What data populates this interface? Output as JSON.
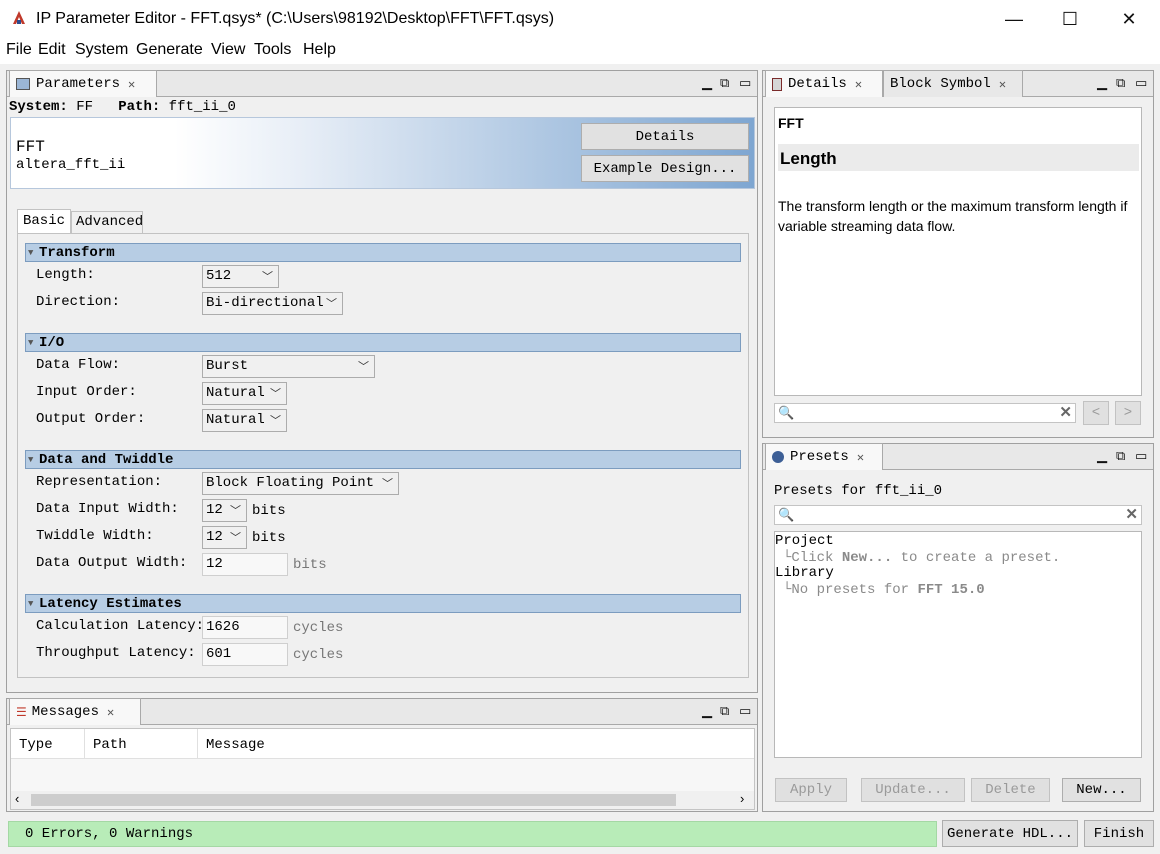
{
  "window": {
    "title": "IP Parameter Editor - FFT.qsys* (C:\\Users\\98192\\Desktop\\FFT\\FFT.qsys)",
    "icon": "quartus-app-icon",
    "minimize": "—",
    "maximize": "☐",
    "close": "✕"
  },
  "menu": [
    "File",
    "Edit",
    "System",
    "Generate",
    "View",
    "Tools",
    "Help"
  ],
  "parameters": {
    "tab_label": "Parameters",
    "system_label": "System:",
    "system_value": "FF",
    "path_label": "Path:",
    "path_value": "fft_ii_0",
    "component_name": "FFT",
    "component_id": "altera_fft_ii",
    "details_button": "Details",
    "example_button": "Example Design...",
    "tabs": [
      "Basic",
      "Advanced"
    ],
    "transform": {
      "title": "Transform",
      "length_label": "Length:",
      "length_value": "512",
      "direction_label": "Direction:",
      "direction_value": "Bi-directional"
    },
    "io": {
      "title": "I/O",
      "data_flow_label": "Data Flow:",
      "data_flow_value": "Burst",
      "input_order_label": "Input Order:",
      "input_order_value": "Natural",
      "output_order_label": "Output Order:",
      "output_order_value": "Natural"
    },
    "data_twiddle": {
      "title": "Data and Twiddle",
      "representation_label": "Representation:",
      "representation_value": "Block Floating Point",
      "input_width_label": "Data Input Width:",
      "input_width_value": "12",
      "twiddle_width_label": "Twiddle Width:",
      "twiddle_width_value": "12",
      "output_width_label": "Data Output Width:",
      "output_width_value": "12",
      "bits": "bits"
    },
    "latency": {
      "title": "Latency Estimates",
      "calc_label": "Calculation Latency:",
      "calc_value": "1626",
      "throughput_label": "Throughput Latency:",
      "throughput_value": "601",
      "cycles": "cycles"
    }
  },
  "details": {
    "tab_label": "Details",
    "tab2_label": "Block Symbol",
    "component": "FFT",
    "heading": "Length",
    "body": "The transform length or the maximum transform length if variable streaming data flow.",
    "prev": "<",
    "next": ">"
  },
  "presets": {
    "tab_label": "Presets",
    "header": "Presets for fft_ii_0",
    "project_label": "Project",
    "project_hint_pre": "Click ",
    "project_hint_bold": "New...",
    "project_hint_post": " to create a preset.",
    "library_label": "Library",
    "library_hint_pre": "No presets for ",
    "library_hint_bold": "FFT 15.0",
    "apply": "Apply",
    "update": "Update...",
    "delete": "Delete",
    "new": "New..."
  },
  "messages": {
    "tab_label": "Messages",
    "columns": [
      "Type",
      "Path",
      "Message"
    ]
  },
  "status": {
    "text": "0 Errors, 0 Warnings",
    "generate_button": "Generate HDL...",
    "finish_button": "Finish"
  },
  "colors": {
    "section_bar": "#b7cde4",
    "status_ok": "#b8ecb8",
    "header_gradient_end": "#7ea6d1"
  }
}
